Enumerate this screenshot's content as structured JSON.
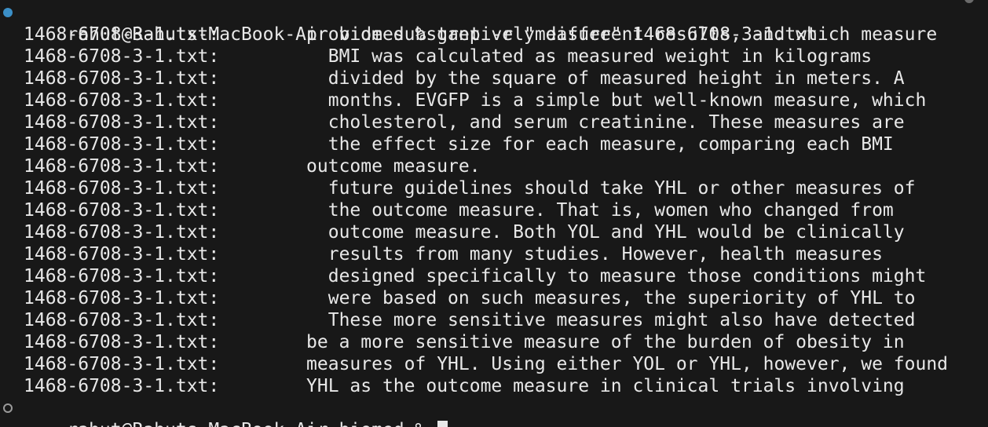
{
  "command_line": {
    "prompt": "rahut@Rahuts-MacBook-Air biomed %",
    "command": "grep -r \"measure\" 1468-6708-3-1.txt"
  },
  "output_lines": [
    {
      "file": "1468-6708-3-1.txt:",
      "text": "        provide substantively different results, and which measure"
    },
    {
      "file": "1468-6708-3-1.txt:",
      "text": "          BMI was calculated as measured weight in kilograms"
    },
    {
      "file": "1468-6708-3-1.txt:",
      "text": "          divided by the square of measured height in meters. A"
    },
    {
      "file": "1468-6708-3-1.txt:",
      "text": "          months. EVGFP is a simple but well-known measure, which"
    },
    {
      "file": "1468-6708-3-1.txt:",
      "text": "          cholesterol, and serum creatinine. These measures are"
    },
    {
      "file": "1468-6708-3-1.txt:",
      "text": "          the effect size for each measure, comparing each BMI"
    },
    {
      "file": "1468-6708-3-1.txt:",
      "text": "        outcome measure."
    },
    {
      "file": "1468-6708-3-1.txt:",
      "text": "          future guidelines should take YHL or other measures of"
    },
    {
      "file": "1468-6708-3-1.txt:",
      "text": "          the outcome measure. That is, women who changed from"
    },
    {
      "file": "1468-6708-3-1.txt:",
      "text": "          outcome measure. Both YOL and YHL would be clinically"
    },
    {
      "file": "1468-6708-3-1.txt:",
      "text": "          results from many studies. However, health measures"
    },
    {
      "file": "1468-6708-3-1.txt:",
      "text": "          designed specifically to measure those conditions might"
    },
    {
      "file": "1468-6708-3-1.txt:",
      "text": "          were based on such measures, the superiority of YHL to"
    },
    {
      "file": "1468-6708-3-1.txt:",
      "text": "          These more sensitive measures might also have detected"
    },
    {
      "file": "1468-6708-3-1.txt:",
      "text": "        be a more sensitive measure of the burden of obesity in"
    },
    {
      "file": "1468-6708-3-1.txt:",
      "text": "        measures of YHL. Using either YOL or YHL, however, we found"
    },
    {
      "file": "1468-6708-3-1.txt:",
      "text": "        YHL as the outcome measure in clinical trials involving"
    }
  ],
  "current_prompt": {
    "prompt": "rahut@Rahuts-MacBook-Air biomed %"
  },
  "colors": {
    "background": "#181818",
    "text": "#e8e8e8",
    "success_marker": "#3b8fc7",
    "idle_marker": "#9a9a9a"
  }
}
